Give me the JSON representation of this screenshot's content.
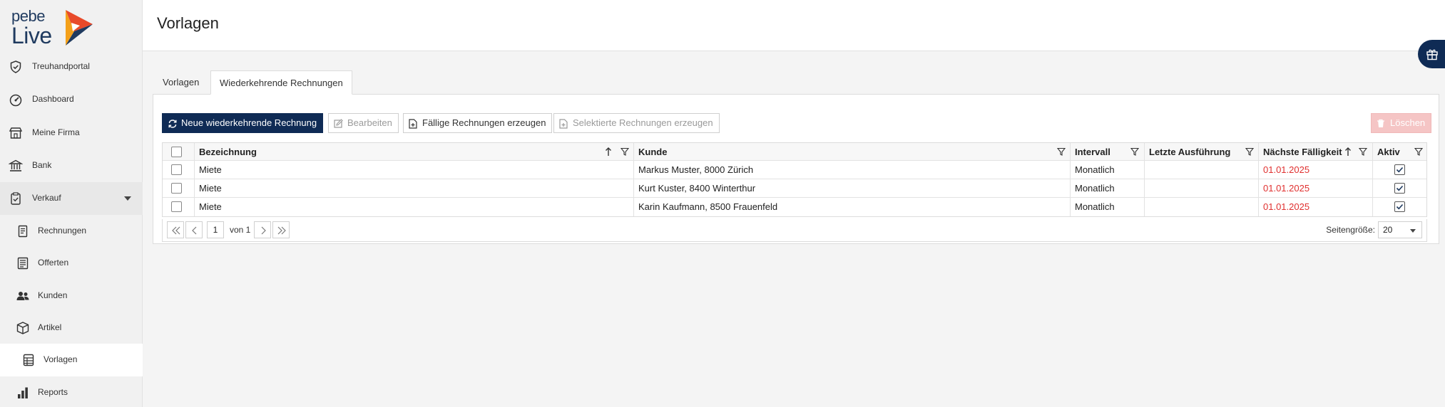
{
  "brand": {
    "line1": "pebe",
    "line2": "Live"
  },
  "sidebar": {
    "items": [
      {
        "label": "Treuhandportal",
        "icon": "shield-check-icon"
      },
      {
        "label": "Dashboard",
        "icon": "speedometer-icon"
      },
      {
        "label": "Meine Firma",
        "icon": "store-icon"
      },
      {
        "label": "Bank",
        "icon": "bank-icon"
      },
      {
        "label": "Verkauf",
        "icon": "clipboard-check-icon"
      }
    ],
    "subitems": [
      {
        "label": "Rechnungen",
        "icon": "document-icon"
      },
      {
        "label": "Offerten",
        "icon": "list-document-icon"
      },
      {
        "label": "Kunden",
        "icon": "people-icon"
      },
      {
        "label": "Artikel",
        "icon": "box-icon"
      },
      {
        "label": "Vorlagen",
        "icon": "template-icon"
      },
      {
        "label": "Reports",
        "icon": "bar-chart-icon"
      }
    ]
  },
  "header": {
    "title": "Vorlagen"
  },
  "tabs": [
    {
      "label": "Vorlagen"
    },
    {
      "label": "Wiederkehrende Rechnungen"
    }
  ],
  "toolbar": {
    "new_label": "Neue wiederkehrende Rechnung",
    "edit_label": "Bearbeiten",
    "generate_due_label": "Fällige Rechnungen erzeugen",
    "generate_selected_label": "Selektierte Rechnungen erzeugen",
    "delete_label": "Löschen"
  },
  "grid": {
    "columns": {
      "name": "Bezeichnung",
      "customer": "Kunde",
      "interval": "Intervall",
      "last_run": "Letzte Ausführung",
      "next_due": "Nächste Fälligkeit",
      "active": "Aktiv"
    },
    "rows": [
      {
        "name": "Miete",
        "customer": "Markus Muster, 8000 Zürich",
        "interval": "Monatlich",
        "last_run": "",
        "next_due": "01.01.2025",
        "active": true
      },
      {
        "name": "Miete",
        "customer": "Kurt Kuster, 8400 Winterthur",
        "interval": "Monatlich",
        "last_run": "",
        "next_due": "01.01.2025",
        "active": true
      },
      {
        "name": "Miete",
        "customer": "Karin Kaufmann, 8500 Frauenfeld",
        "interval": "Monatlich",
        "last_run": "",
        "next_due": "01.01.2025",
        "active": true
      }
    ]
  },
  "pager": {
    "page": "1",
    "of_label": "von 1",
    "page_size_label": "Seitengröße:",
    "page_size": "20"
  },
  "colors": {
    "primary": "#0f2b55",
    "due": "#e0302f",
    "danger_disabled": "#f5c5c5"
  }
}
